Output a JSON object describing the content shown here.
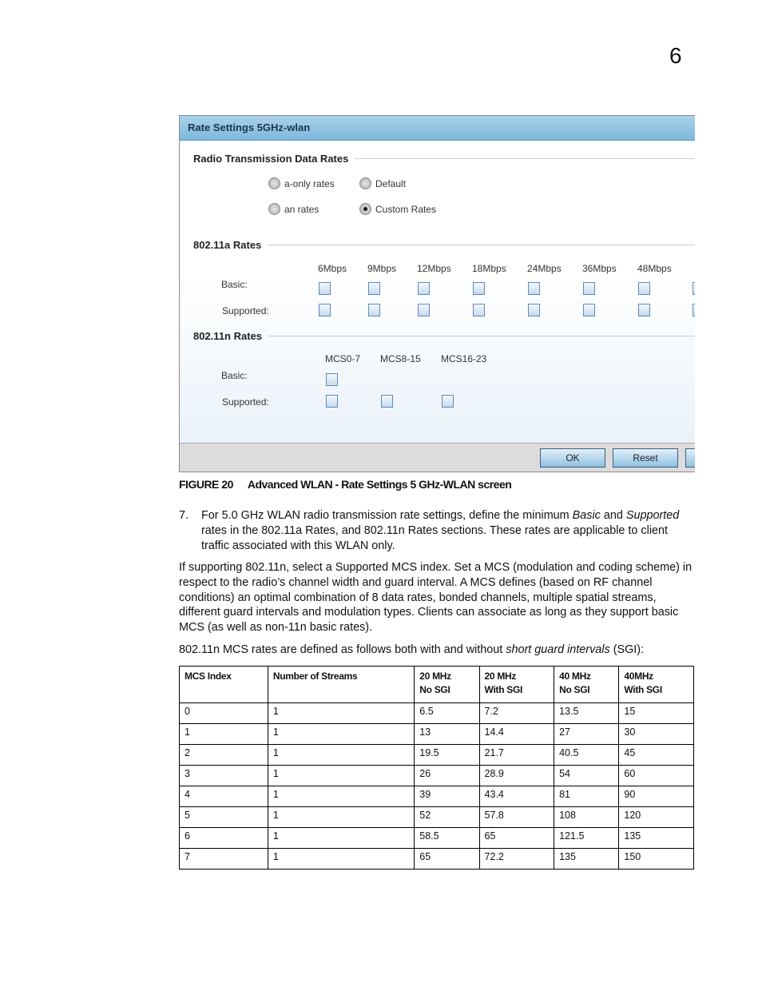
{
  "chapter_number": "6",
  "dialog": {
    "title": "Rate Settings 5GHz-wlan",
    "radio_section": "Radio Transmission Data Rates",
    "radios": [
      {
        "label": "a-only rates",
        "selected": false
      },
      {
        "label": "Default",
        "selected": false
      },
      {
        "label": "an rates",
        "selected": false
      },
      {
        "label": "Custom Rates",
        "selected": true
      }
    ],
    "a_section": "802.11a  Rates",
    "a_rates": [
      "6Mbps",
      "9Mbps",
      "12Mbps",
      "18Mbps",
      "24Mbps",
      "36Mbps",
      "48Mbps"
    ],
    "basic_label": "Basic:",
    "supported_label": "Supported:",
    "n_section": "802.11n Rates",
    "n_rates": [
      "MCS0-7",
      "MCS8-15",
      "MCS16-23"
    ],
    "ok": "OK",
    "reset": "Reset"
  },
  "caption": {
    "number": "FIGURE 20",
    "text": "Advanced WLAN - Rate Settings 5 GHz-WLAN screen"
  },
  "step": {
    "num": "7.",
    "t1": "For 5.0 GHz WLAN radio transmission rate settings, define the minimum ",
    "i1": "Basic",
    "t2": " and ",
    "i2": "Supported",
    "t3": " rates in the ",
    "b1": "802.11a Rates",
    "t4": ", and ",
    "b2": "802.11n Rates",
    "t5": " sections. These rates are applicable to client traffic associated with this WLAN only."
  },
  "para1": "If supporting 802.11n, select a Supported MCS index. Set a MCS (modulation and coding scheme) in respect to the radio’s channel width and guard interval. A MCS defines (based on RF channel conditions) an optimal combination of 8 data rates, bonded channels, multiple spatial streams, different guard intervals and modulation types. Clients can associate as long as they support basic MCS (as well as non-11n basic rates).",
  "para2": {
    "t1": "802.11n MCS rates are defined as follows both with and without ",
    "i1": "short guard intervals",
    "t2": " (SGI):"
  },
  "table": {
    "headers": [
      [
        "MCS Index"
      ],
      [
        "Number of Streams"
      ],
      [
        "20 MHz",
        "No SGI"
      ],
      [
        "20 MHz",
        "With SGI"
      ],
      [
        "40 MHz",
        "No SGI"
      ],
      [
        "40MHz",
        "With SGI"
      ]
    ],
    "rows": [
      [
        "0",
        "1",
        "6.5",
        "7.2",
        "13.5",
        "15"
      ],
      [
        "1",
        "1",
        "13",
        "14.4",
        "27",
        "30"
      ],
      [
        "2",
        "1",
        "19.5",
        "21.7",
        "40.5",
        "45"
      ],
      [
        "3",
        "1",
        "26",
        "28.9",
        "54",
        "60"
      ],
      [
        "4",
        "1",
        "39",
        "43.4",
        "81",
        "90"
      ],
      [
        "5",
        "1",
        "52",
        "57.8",
        "108",
        "120"
      ],
      [
        "6",
        "1",
        "58.5",
        "65",
        "121.5",
        "135"
      ],
      [
        "7",
        "1",
        "65",
        "72.2",
        "135",
        "150"
      ]
    ]
  }
}
